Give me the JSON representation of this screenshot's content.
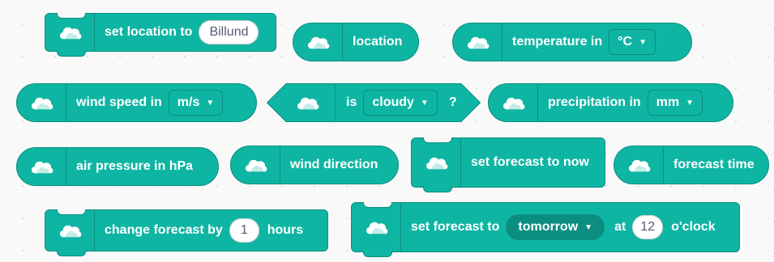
{
  "colors": {
    "block": "#0fb5a3",
    "block_border": "#0b8e80",
    "dark_dropdown": "#0b8e80",
    "text": "#ffffff",
    "input_text": "#575e75",
    "background": "#f9f9f9"
  },
  "icon": "cloud-icon",
  "blocks": {
    "set_location": {
      "label": "set location to",
      "value": "Billund"
    },
    "location": {
      "label": "location"
    },
    "temperature": {
      "label": "temperature in",
      "unit": "°C"
    },
    "wind_speed": {
      "label": "wind speed in",
      "unit": "m/s"
    },
    "is_cloudy": {
      "label": "is",
      "option": "cloudy",
      "suffix": "?"
    },
    "precipitation": {
      "label": "precipitation in",
      "unit": "mm"
    },
    "air_pressure": {
      "label": "air pressure in hPa"
    },
    "wind_direction": {
      "label": "wind direction"
    },
    "set_forecast_now": {
      "label": "set forecast to now"
    },
    "forecast_time": {
      "label": "forecast time"
    },
    "change_forecast": {
      "label": "change forecast by",
      "value": "1",
      "suffix": "hours"
    },
    "set_forecast_to": {
      "label": "set forecast to",
      "option": "tomorrow",
      "at_label": "at",
      "hour": "12",
      "suffix": "o'clock"
    }
  }
}
